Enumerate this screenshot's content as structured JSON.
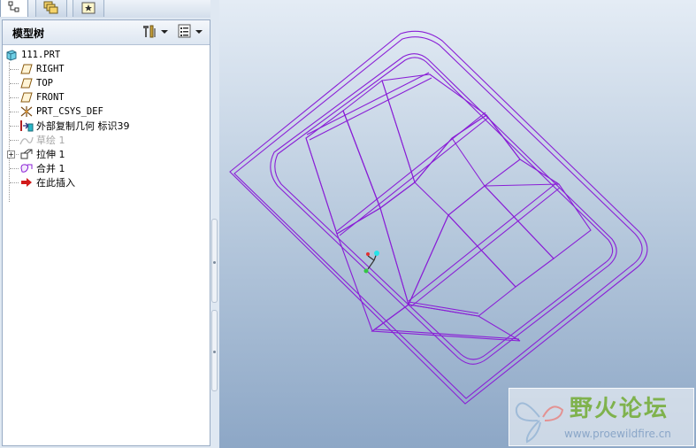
{
  "tabs": [
    {
      "name": "model-tree",
      "icon": "model-tree-icon",
      "active": true
    },
    {
      "name": "folder-browser",
      "icon": "folder-browser-icon",
      "active": false
    },
    {
      "name": "favorites",
      "icon": "favorites-icon",
      "active": false
    }
  ],
  "tree": {
    "title": "模型树",
    "settings_icon": "settings-icon",
    "show_icon": "show-icon",
    "items": [
      {
        "label": "111.PRT",
        "icon": "part-icon",
        "dim": false
      },
      {
        "label": "RIGHT",
        "icon": "datum-plane-icon",
        "dim": false
      },
      {
        "label": "TOP",
        "icon": "datum-plane-icon",
        "dim": false
      },
      {
        "label": "FRONT",
        "icon": "datum-plane-icon",
        "dim": false
      },
      {
        "label": "PRT_CSYS_DEF",
        "icon": "csys-icon",
        "dim": false
      },
      {
        "label": "外部复制几何 标识39",
        "icon": "external-copy-geometry-icon",
        "dim": false
      },
      {
        "label": "草绘 1",
        "icon": "sketch-icon",
        "dim": true
      },
      {
        "label": "拉伸 1",
        "icon": "extrude-icon",
        "dim": false
      },
      {
        "label": "合并 1",
        "icon": "merge-icon",
        "dim": false
      },
      {
        "label": "在此插入",
        "icon": "insert-here-arrow-icon",
        "dim": false
      }
    ]
  },
  "watermark": {
    "title": "野火论坛",
    "url": "www.proewildfire.cn"
  },
  "colors": {
    "model_edge": "#8a1fd6",
    "viewport_top": "#e4ecf5",
    "viewport_bottom": "#8da7c6",
    "watermark_green": "#7fb24d"
  }
}
